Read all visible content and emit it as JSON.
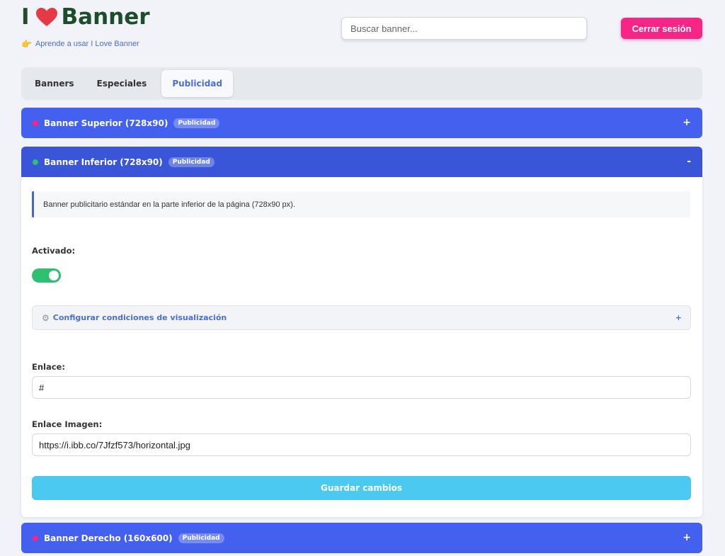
{
  "header": {
    "logo_left": "I",
    "logo_right": "Banner",
    "learn_link": "Aprende a usar I Love Banner",
    "search_placeholder": "Buscar banner...",
    "logout_label": "Cerrar sesión"
  },
  "tabs": [
    {
      "label": "Banners",
      "active": false
    },
    {
      "label": "Especiales",
      "active": false
    },
    {
      "label": "Publicidad",
      "active": true
    }
  ],
  "banners": [
    {
      "title": "Banner Superior (728x90)",
      "badge": "Publicidad",
      "dot_color": "#f72585",
      "toggle": "+"
    },
    {
      "title": "Banner Inferior (728x90)",
      "badge": "Publicidad",
      "dot_color": "#2fbf71",
      "toggle": "-"
    },
    {
      "title": "Banner Derecho (160x600)",
      "badge": "Publicidad",
      "dot_color": "#f72585",
      "toggle": "+"
    }
  ],
  "open_banner": {
    "description": "Banner publicitario estándar en la parte inferior de la página (728x90 px).",
    "activated_label": "Activado:",
    "activated": true,
    "conditions_label": "Configurar condiciones de visualización",
    "conditions_toggle": "+",
    "link_label": "Enlace:",
    "link_value": "#",
    "image_link_label": "Enlace Imagen:",
    "image_link_value": "https://i.ibb.co/7Jfzf573/horizontal.jpg",
    "save_label": "Guardar cambios"
  },
  "colors": {
    "accent": "#4361ee",
    "logout": "#f72585",
    "save": "#4cc9f0",
    "toggle_on": "#2fbf71",
    "logo": "#1e4d2b",
    "heart": "#e63946"
  },
  "icons": {
    "heart": "heart-icon",
    "hand": "pointing-hand-icon",
    "gear": "gear-icon"
  }
}
